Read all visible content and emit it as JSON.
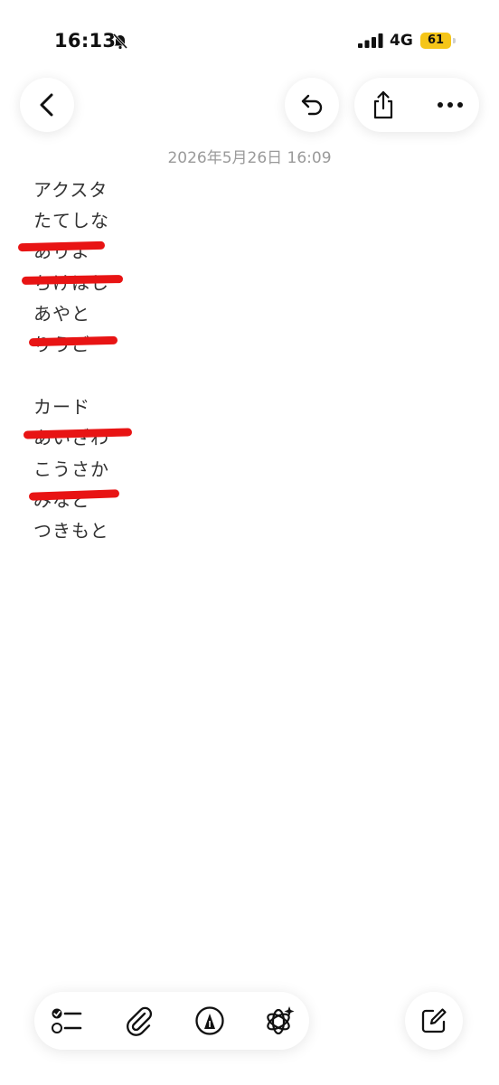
{
  "status_bar": {
    "time": "16:13",
    "network": "4G",
    "battery": "61"
  },
  "note": {
    "date": "2026年5月26日 16:09",
    "lines": [
      {
        "text": "アクスタ",
        "struck": false
      },
      {
        "text": "たてしな",
        "struck": false
      },
      {
        "text": "ありよ",
        "struck": true
      },
      {
        "text": "ちけほし",
        "struck": true
      },
      {
        "text": "あやと",
        "struck": false
      },
      {
        "text": "りうご",
        "struck": true
      },
      {
        "text": "",
        "struck": false
      },
      {
        "text": "カード",
        "struck": false
      },
      {
        "text": "あいざわ",
        "struck": true
      },
      {
        "text": "こうさか",
        "struck": false
      },
      {
        "text": "みなど",
        "struck": true
      },
      {
        "text": "つきもと",
        "struck": false
      }
    ]
  },
  "colors": {
    "strike": "#e81414",
    "battery": "#f5c518",
    "background": "#ffffff"
  },
  "icons": {
    "nav": [
      "back-chevron-icon",
      "undo-icon",
      "share-icon",
      "more-icon"
    ],
    "toolbar": [
      "checklist-icon",
      "paperclip-icon",
      "markup-pen-icon",
      "apple-intelligence-icon",
      "compose-icon"
    ]
  }
}
